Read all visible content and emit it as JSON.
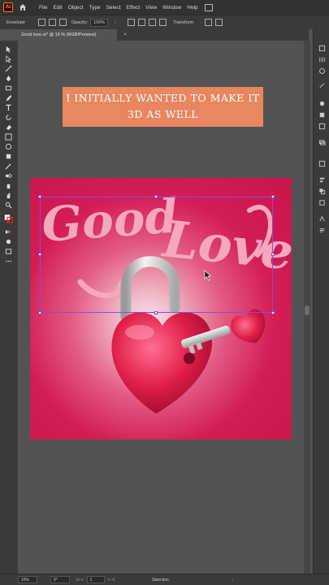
{
  "menubar": {
    "logo": "Ai",
    "items": [
      "File",
      "Edit",
      "Object",
      "Type",
      "Select",
      "Effect",
      "View",
      "Window",
      "Help"
    ]
  },
  "controlbar": {
    "mode_label": "Envelope",
    "opacity_label": "Opacity:",
    "opacity_value": "100%",
    "transform_label": "Transform"
  },
  "document": {
    "tab_title": "Good love.ai* @ 16 % (RGB/Preview)",
    "close_glyph": "×"
  },
  "caption": {
    "line1": "I INITIALLY WANTED TO MAKE IT",
    "line2": "3D AS WELL"
  },
  "artwork": {
    "text": "Good Love",
    "background_color": "#cc1a50",
    "text_color": "#f5a8bc",
    "heart_color": "#e01e4a",
    "shackle_color": "#d9d9d9"
  },
  "statusbar": {
    "zoom": "16%",
    "rotation": "0°",
    "artboard_num": "1",
    "tool_label": "Selection"
  },
  "icons": [
    "selection-tool-icon",
    "direct-selection-tool-icon",
    "pen-tool-icon",
    "type-tool-icon",
    "zoom-tool-icon",
    "hand-tool-icon"
  ]
}
